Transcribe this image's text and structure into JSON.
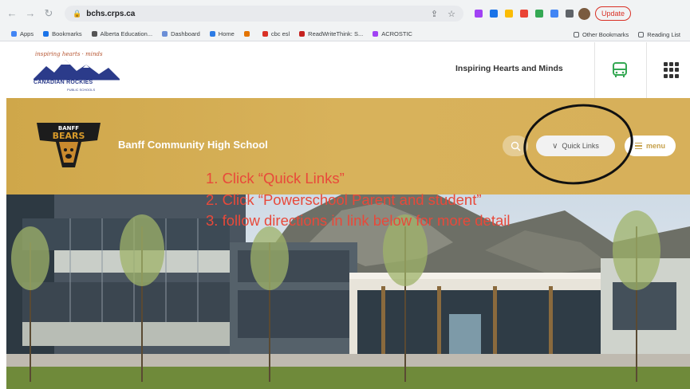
{
  "browser": {
    "url": "bchs.crps.ca",
    "update_label": "Update",
    "bookmarks": [
      {
        "label": "Apps",
        "color": "#4285f4"
      },
      {
        "label": "Bookmarks",
        "color": "#1a73e8"
      },
      {
        "label": "Alberta Education...",
        "color": "#555555"
      },
      {
        "label": "Dashboard",
        "color": "#6b8ed6"
      },
      {
        "label": "Home",
        "color": "#2c7be5"
      },
      {
        "label": "",
        "color": "#e37400"
      },
      {
        "label": "cbc esl",
        "color": "#d93025"
      },
      {
        "label": "ReadWriteThink: S...",
        "color": "#c5221f"
      },
      {
        "label": "ACROSTIC",
        "color": "#a142f4"
      }
    ],
    "bookmarks_right": [
      {
        "label": "Other Bookmarks"
      },
      {
        "label": "Reading List"
      }
    ]
  },
  "header": {
    "logo_tagline": "inspiring hearts  ·  minds",
    "logo_name": "CANADIAN ROCKIES",
    "logo_sub": "PUBLIC SCHOOLS",
    "tagline": "Inspiring Hearts and Minds"
  },
  "banner": {
    "logo_top": "BANFF",
    "logo_bottom": "BEARS",
    "school_name": "Banff Community High School",
    "quick_links_label": "Quick Links",
    "menu_label": "menu"
  },
  "instructions": [
    "1. Click “Quick Links”",
    "2. Click “Powerschool Parent and student”",
    "3. follow directions in link below for more detail"
  ],
  "colors": {
    "banner_gold": "#d3ad55",
    "annotation_red": "#e8493a",
    "menu_gold": "#c6a04a"
  }
}
